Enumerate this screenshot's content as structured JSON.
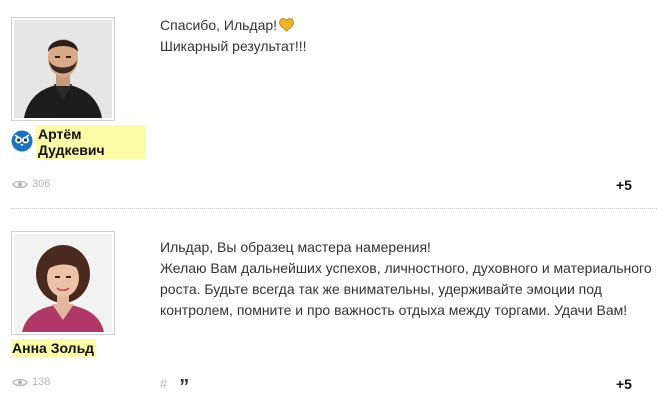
{
  "comments": [
    {
      "author": "Артём Дудкевич",
      "text_lines": [
        "Спасибо, Ильдар!",
        "Шикарный результат!!!"
      ],
      "views": "306",
      "score": "+5",
      "icons": [
        "owl-badge-icon",
        "heart-icon",
        "eye-icon"
      ]
    },
    {
      "author": "Анна Зольд",
      "text_lines": [
        "Ильдар, Вы образец мастера намерения!",
        "Желаю Вам дальнейших успехов, личностного, духовного и материального",
        "роста. Будьте всегда так же внимательны, удерживайте эмоции под",
        "контролем, помните и про важность отдыха между торгами. Удачи Вам!"
      ],
      "views": "138",
      "hash": "#",
      "quote": "”",
      "score": "+5",
      "icons": [
        "eye-icon",
        "hash-icon",
        "quote-icon"
      ]
    }
  ],
  "colors": {
    "name_highlight": "#fcfca8",
    "muted": "#b5b5b5",
    "heart": "#f0b32a",
    "badge": "#1e73be"
  }
}
